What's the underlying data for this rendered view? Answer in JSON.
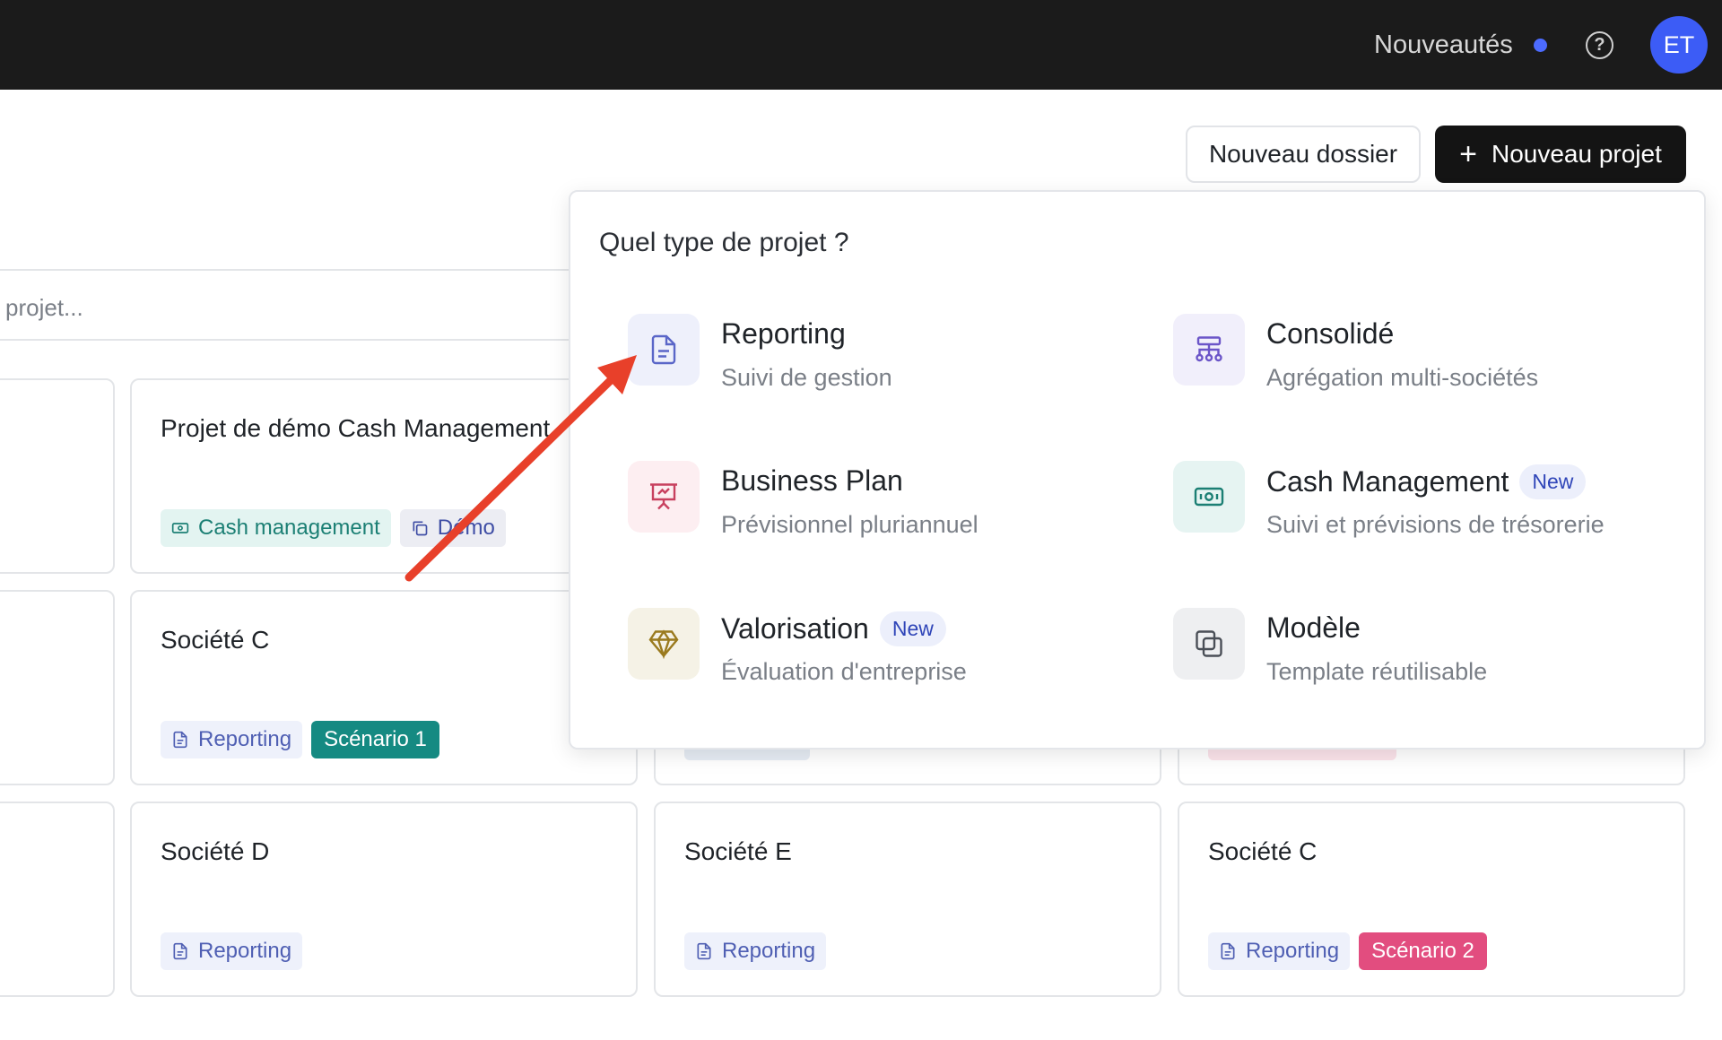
{
  "topbar": {
    "news_label": "Nouveautés",
    "help_icon": "help-circle-icon",
    "avatar_initials": "ET",
    "accent_color": "#3c5cf6"
  },
  "actions": {
    "new_folder": "Nouveau dossier",
    "new_project": "Nouveau projet"
  },
  "search": {
    "placeholder": "projet..."
  },
  "cards": [
    {
      "title": "Projet de démo Cash Management",
      "tags": [
        "Cash management",
        "Démo"
      ]
    },
    {
      "title": "Société C",
      "tags": [
        "Reporting",
        "Scénario 1"
      ]
    },
    {
      "title": "Société D",
      "tags": [
        "Reporting"
      ]
    },
    {
      "title": "Société E",
      "tags": [
        "Reporting"
      ]
    },
    {
      "title": "Société C",
      "tags": [
        "Reporting",
        "Scénario 2"
      ]
    }
  ],
  "popover": {
    "title": "Quel type de projet ?",
    "options": [
      {
        "title": "Reporting",
        "subtitle": "Suivi de gestion",
        "icon": "document-icon"
      },
      {
        "title": "Consolidé",
        "subtitle": "Agrégation multi-sociétés",
        "icon": "hierarchy-icon"
      },
      {
        "title": "Business Plan",
        "subtitle": "Prévisionnel pluriannuel",
        "icon": "presentation-icon"
      },
      {
        "title": "Cash Management",
        "subtitle": "Suivi et prévisions de trésorerie",
        "icon": "banknote-icon",
        "badge": "New"
      },
      {
        "title": "Valorisation",
        "subtitle": "Évaluation d'entreprise",
        "icon": "diamond-icon",
        "badge": "New"
      },
      {
        "title": "Modèle",
        "subtitle": "Template réutilisable",
        "icon": "copy-icon"
      }
    ]
  },
  "colors": {
    "scenario1": "#158a82",
    "scenario2": "#e24d7f",
    "annotation_arrow": "#e8402a"
  }
}
